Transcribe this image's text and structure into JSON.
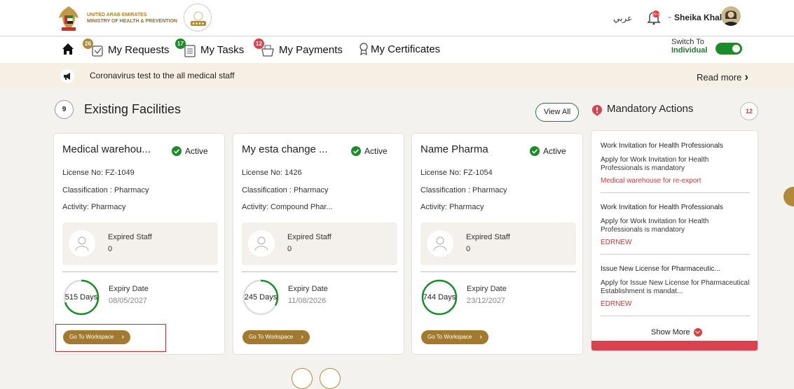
{
  "header": {
    "org_line1": "UNITED ARAB EMIRATES",
    "org_line2": "MINISTRY OF HEALTH & PREVENTION",
    "language_label": "عربي",
    "user_name": "Sheika Khalid"
  },
  "nav": {
    "requests_label": "My Requests",
    "requests_count": "26",
    "tasks_label": "My Tasks",
    "tasks_count": "17",
    "payments_label": "My Payments",
    "payments_count": "12",
    "certificates_label": "My Certificates",
    "switch_to_label": "Switch To",
    "switch_target": "Individual"
  },
  "announcement": {
    "text": "Coronavirus test to the all medical staff",
    "read_more": "Read more"
  },
  "facilities": {
    "count": "9",
    "title": "Existing Facilities",
    "view_all": "View All",
    "cards": [
      {
        "name": "Medical warehou...",
        "status": "Active",
        "license": "License No:  FZ-1049",
        "classification": "Classification :  Pharmacy",
        "activity": "Activity:  Pharmacy",
        "staff_label": "Expired Staff",
        "staff_value": "0",
        "days": "515 Days",
        "days_fraction": 0.7,
        "expiry_label": "Expiry Date",
        "expiry_date": "08/05/2027",
        "workspace_label": "Go To Workspace"
      },
      {
        "name": "My esta change ...",
        "status": "Active",
        "license": "License No:  1426",
        "classification": "Classification :  Pharmacy",
        "activity": "Activity:  Compound Phar...",
        "staff_label": "Expired Staff",
        "staff_value": "0",
        "days": "245 Days",
        "days_fraction": 0.33,
        "expiry_label": "Expiry Date",
        "expiry_date": "11/08/2026",
        "workspace_label": "Go To Workspace"
      },
      {
        "name": "Name Pharma",
        "status": "Active",
        "license": "License No:  FZ-1054",
        "classification": "Classification :  Pharmacy",
        "activity": "Activity:  Pharmacy",
        "staff_label": "Expired Staff",
        "staff_value": "0",
        "days": "744 Days",
        "days_fraction": 1.0,
        "expiry_label": "Expiry Date",
        "expiry_date": "23/12/2027",
        "workspace_label": "Go To Workspace"
      }
    ]
  },
  "mandatory": {
    "title": "Mandatory Actions",
    "count": "12",
    "items": [
      {
        "title": "Work Invitation for Health Professionals",
        "desc": "Apply for Work Invitation for Health Professionals is mandatory",
        "facility": "Medical warehouse for re-export"
      },
      {
        "title": "Work Invitation for Health Professionals",
        "desc": "Apply for Work Invitation for Health Professionals is mandatory",
        "facility": "EDRNEW"
      },
      {
        "title": "Issue New License for Pharmaceutic...",
        "desc": "Apply for Issue New License for Pharmaceutical Establishment is mandat...",
        "facility": "EDRNEW"
      }
    ],
    "show_more": "Show More"
  },
  "colors": {
    "accent_gold": "#a27a2f",
    "active_green": "#1a8d2a",
    "alert_red": "#c43a3a"
  }
}
